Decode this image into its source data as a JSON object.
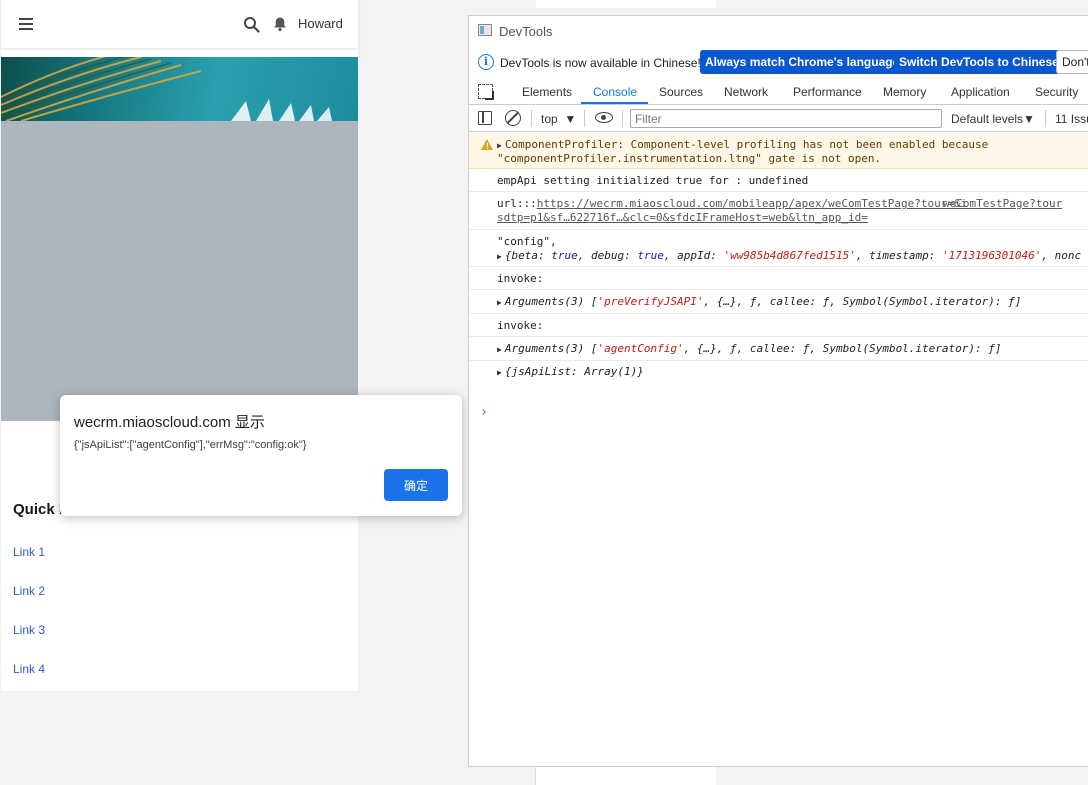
{
  "mobile": {
    "user_name": "Howard",
    "quick_links_title": "Quick L",
    "links": [
      "Link 1",
      "Link 2",
      "Link 3",
      "Link 4"
    ]
  },
  "alert": {
    "title": "wecrm.miaoscloud.com 显示",
    "message": "{\"jsApiList\":[\"agentConfig\"],\"errMsg\":\"config:ok\"}",
    "ok_label": "确定"
  },
  "devtools": {
    "window_title": "DevTools",
    "info_text": "DevTools is now available in Chinese!",
    "btn_match": "Always match Chrome's language",
    "btn_switch": "Switch DevTools to Chinese",
    "btn_dont": "Don't",
    "tabs": [
      "Elements",
      "Console",
      "Sources",
      "Network",
      "Performance",
      "Memory",
      "Application",
      "Security"
    ],
    "context": "top",
    "filter_placeholder": "Filter",
    "levels": "Default levels",
    "issues": "11 Issu",
    "messages": {
      "warn_line1": "ComponentProfiler: Component-level profiling has not been enabled because",
      "warn_line2": "\"componentProfiler.instrumentation.ltng\" gate is not open.",
      "empapi": "empApi setting initialized true for : undefined",
      "url_prefix": "url:::",
      "url_link": "https://wecrm.miaoscloud.com/mobileapp/apex/weComTestPage?tour=&i",
      "url_source": "weComTestPage?tour",
      "url_line2": "sdtp=p1&sf…622716f…&clc=0&sfdcIFrameHost=web&ltn_app_id=",
      "config_label": "\"config\",",
      "config_obj": {
        "open": "{",
        "beta_key": "beta",
        "beta_val": "true",
        "debug_key": "debug",
        "debug_val": "true",
        "appid_key": "appId",
        "appid_val": "'ww985b4d867fed1515'",
        "ts_key": "timestamp",
        "ts_val": "'1713196301046'",
        "nonce_key": "nonc"
      },
      "invoke1": "invoke:",
      "args1": {
        "head": "Arguments(3) [",
        "first": "'preVerifyJSAPI'",
        "rest": ", {…}, ƒ, callee: ƒ, Symbol(Symbol.iterator): ƒ]"
      },
      "invoke2": "invoke:",
      "args2": {
        "head": "Arguments(3) [",
        "first": "'agentConfig'",
        "rest": ", {…}, ƒ, callee: ƒ, Symbol(Symbol.iterator): ƒ]"
      },
      "jsapi": "{jsApiList: Array(1)}"
    }
  }
}
